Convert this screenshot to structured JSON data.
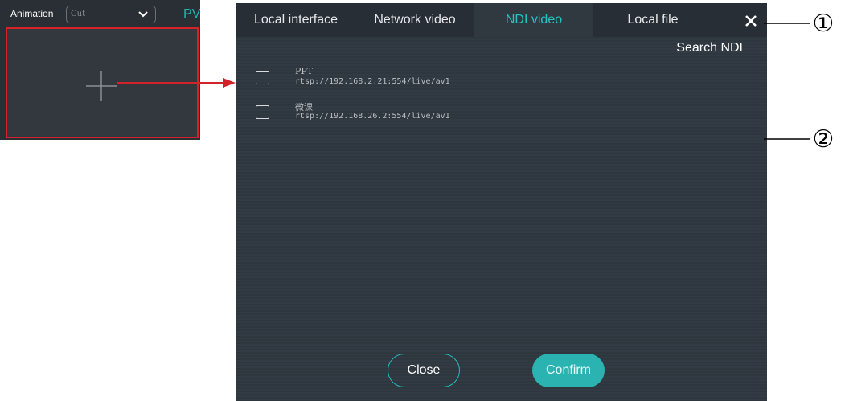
{
  "mini_panel": {
    "animation_label": "Animation",
    "transition_value": "Cut",
    "pv_label": "PV"
  },
  "dialog": {
    "tabs": [
      {
        "label": "Local interface",
        "active": false
      },
      {
        "label": "Network video",
        "active": false
      },
      {
        "label": "NDI video",
        "active": true
      },
      {
        "label": "Local file",
        "active": false
      }
    ],
    "search_label": "Search NDI",
    "sources": [
      {
        "name": "PPT",
        "url": "rtsp://192.168.2.21:554/live/av1",
        "checked": false
      },
      {
        "name": "微课",
        "url": "rtsp://192.168.26.2:554/live/av1",
        "checked": false
      }
    ],
    "close_button": "Close",
    "confirm_button": "Confirm"
  },
  "callouts": [
    "①",
    "②"
  ],
  "colors": {
    "accent": "#22c4c4",
    "highlight_red": "#d3222a",
    "dialog_bg": "#323b43",
    "tabbar_bg": "#282e35"
  },
  "icons": [
    "chevron-down-icon",
    "plus-icon",
    "close-icon",
    "arrow-right-icon"
  ]
}
